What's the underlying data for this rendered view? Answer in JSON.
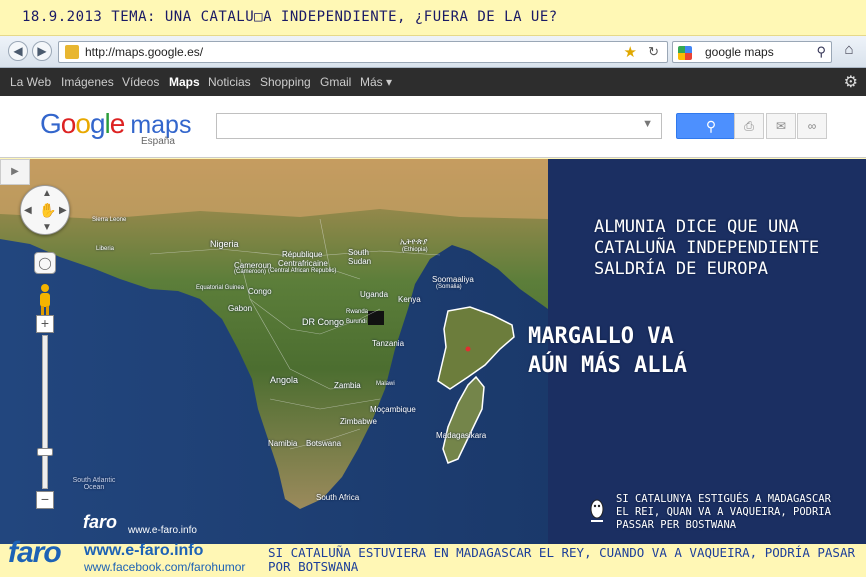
{
  "header_caption": "18.9.2013 TEMA: UNA CATALU□A INDEPENDIENTE, ¿FUERA DE LA UE?",
  "browser": {
    "back_icon": "back-arrow-icon",
    "forward_icon": "forward-arrow-icon",
    "url": "http://maps.google.es/",
    "search_value": "google maps",
    "search_engine_icon": "google-icon",
    "home_icon": "home-icon"
  },
  "google_bar": {
    "items": [
      "La Web",
      "Imágenes",
      "Vídeos",
      "Maps",
      "Noticias",
      "Shopping",
      "Gmail",
      "Más ▾"
    ],
    "active": "Maps"
  },
  "maps_header": {
    "logo_google": [
      "G",
      "o",
      "o",
      "g",
      "l",
      "e"
    ],
    "logo_maps": "maps",
    "logo_country": "España",
    "search_value": "",
    "search_button_icon": "search-icon",
    "tools": [
      "print-icon",
      "mail-icon",
      "link-icon"
    ]
  },
  "map": {
    "labels": {
      "nigeria": "Nigeria",
      "republique": "République",
      "centrafricaine": "Centrafricaine",
      "car_en": "(Central African Republic)",
      "south": "South",
      "sudan": "Sudan",
      "cameroun": "Cameroun",
      "cameroon": "(Cameroon)",
      "ethiopia": "ኢትዮጵያ",
      "ethiopia_en": "(Ethiopia)",
      "somaalia": "Soomaaliya",
      "somalia": "(Somalia)",
      "uganda": "Uganda",
      "kenya": "Kenya",
      "dr_congo": "DR Congo",
      "rwanda": "Rwanda",
      "burundi": "Burundi",
      "tanzania": "Tanzania",
      "angola": "Angola",
      "zambia": "Zambia",
      "malawi": "Malawi",
      "mozambique": "Moçambique",
      "zimbabwe": "Zimbabwe",
      "namibia": "Namibia",
      "botswana": "Botswana",
      "south_africa": "South Africa",
      "madagasikara": "Madagasikara",
      "eq_guinea": "Equatorial Guinea",
      "gabon": "Gabon",
      "congo": "Congo",
      "sierra_leone": "Sierra Leone",
      "liberia": "Liberia",
      "south_atlantic": "South Atlantic Ocean"
    },
    "caption_1": [
      "ALMUNIA DICE QUE UNA",
      "CATALUÑA INDEPENDIENTE",
      "SALDRÍA DE EUROPA"
    ],
    "caption_2": [
      "MARGALLO VA",
      "AÚN MÁS ALLÁ"
    ],
    "caption_3": [
      "SI CATALUNYA ESTIGUÉS A MADAGASCAR",
      "EL REI, QUAN VA A VAQUEIRA, PODRIA",
      "PASSAR PER BOSTWANA"
    ],
    "watermark_logo": "faro",
    "watermark_url": "www.e-faro.info",
    "controls": {
      "zoom_in": "+",
      "zoom_out": "−",
      "zoom_level_fraction": 0.75,
      "pan_icon": "hand-icon",
      "rotate_icon": "rotate-icon",
      "pegman_icon": "pegman-icon",
      "sidebar_toggle_icon": "chevron-right-icon"
    }
  },
  "footer": {
    "logo": "faro",
    "site": "www.e-faro.info",
    "facebook": "www.facebook.com/farohumor",
    "caption": "SI CATALUÑA ESTUVIERA EN MADAGASCAR EL REY, CUANDO VA A VAQUEIRA, PODRÍA PASAR POR BOTSWANA"
  }
}
